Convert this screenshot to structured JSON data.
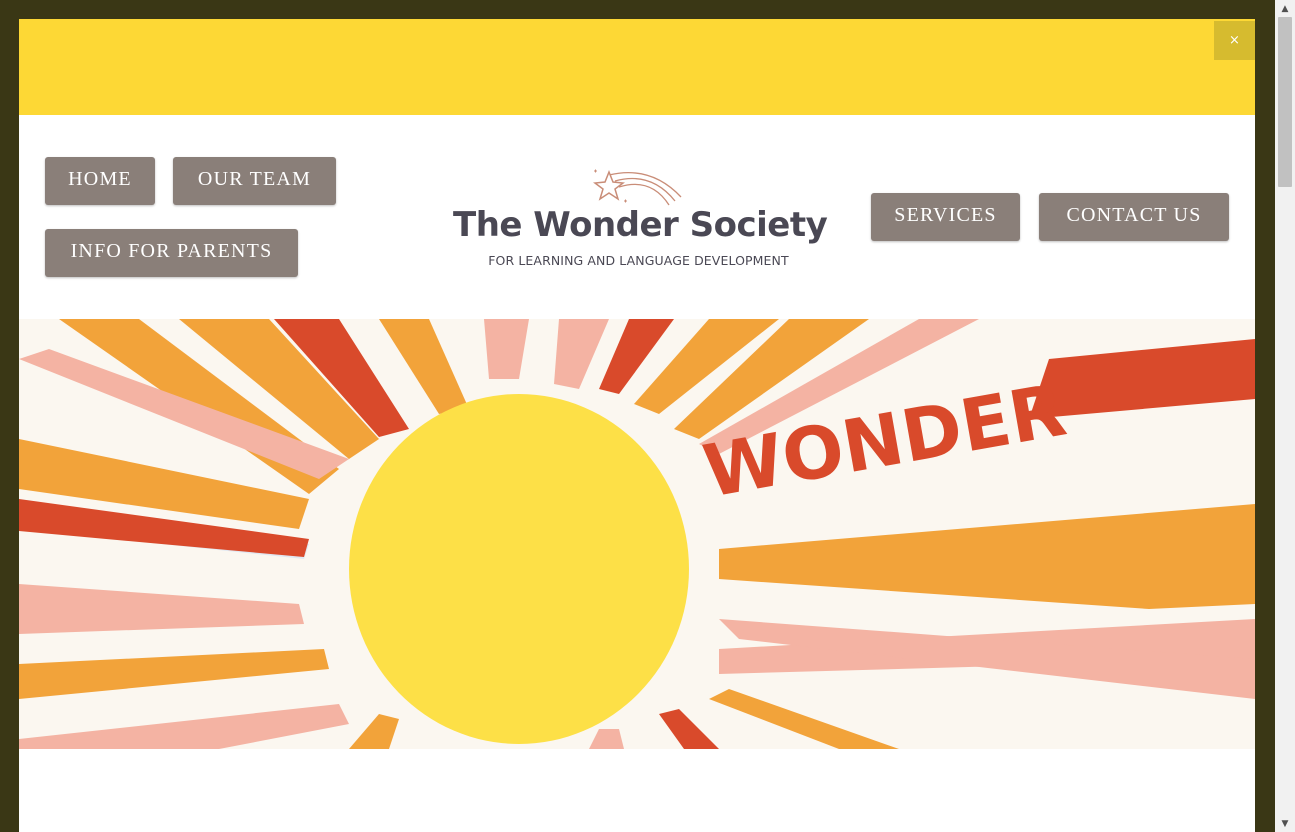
{
  "banner": {
    "close_label": "×",
    "color": "#fdd835"
  },
  "nav": {
    "home": "HOME",
    "our_team": "OUR TEAM",
    "info_for_parents": "INFO FOR PARENTS",
    "services": "SERVICES",
    "contact_us": "CONTACT US",
    "button_color": "#8a7f79"
  },
  "logo": {
    "title": "The Wonder Society",
    "subtitle": "FOR LEARNING AND LANGUAGE DEVELOPMENT",
    "star_icon": "shooting-star-icon"
  },
  "hero": {
    "mural_text": "WONDER",
    "colors": {
      "sun": "#fde047",
      "red": "#d94a2b",
      "orange": "#f2a33a",
      "pink": "#f4b3a3"
    }
  },
  "scrollbar": {
    "up_icon": "▲",
    "down_icon": "▼"
  }
}
